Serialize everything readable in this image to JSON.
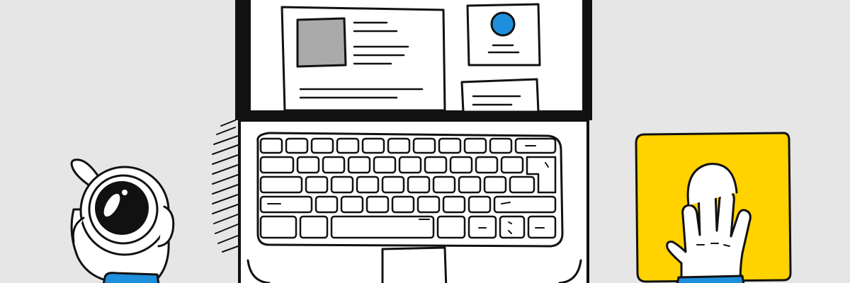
{
  "scene": {
    "background_color": "#e6e6e6",
    "outline_color": "#111111",
    "accent_yellow": "#ffd200",
    "accent_blue": "#1e8fdc",
    "placeholder_gray": "#aaaaaa",
    "elements": {
      "laptop": "laptop-icon",
      "coffee_cup": "coffee-cup-icon",
      "hand_with_cup": "hand-icon",
      "sticky_note_hand": "waving-hand-icon"
    }
  }
}
